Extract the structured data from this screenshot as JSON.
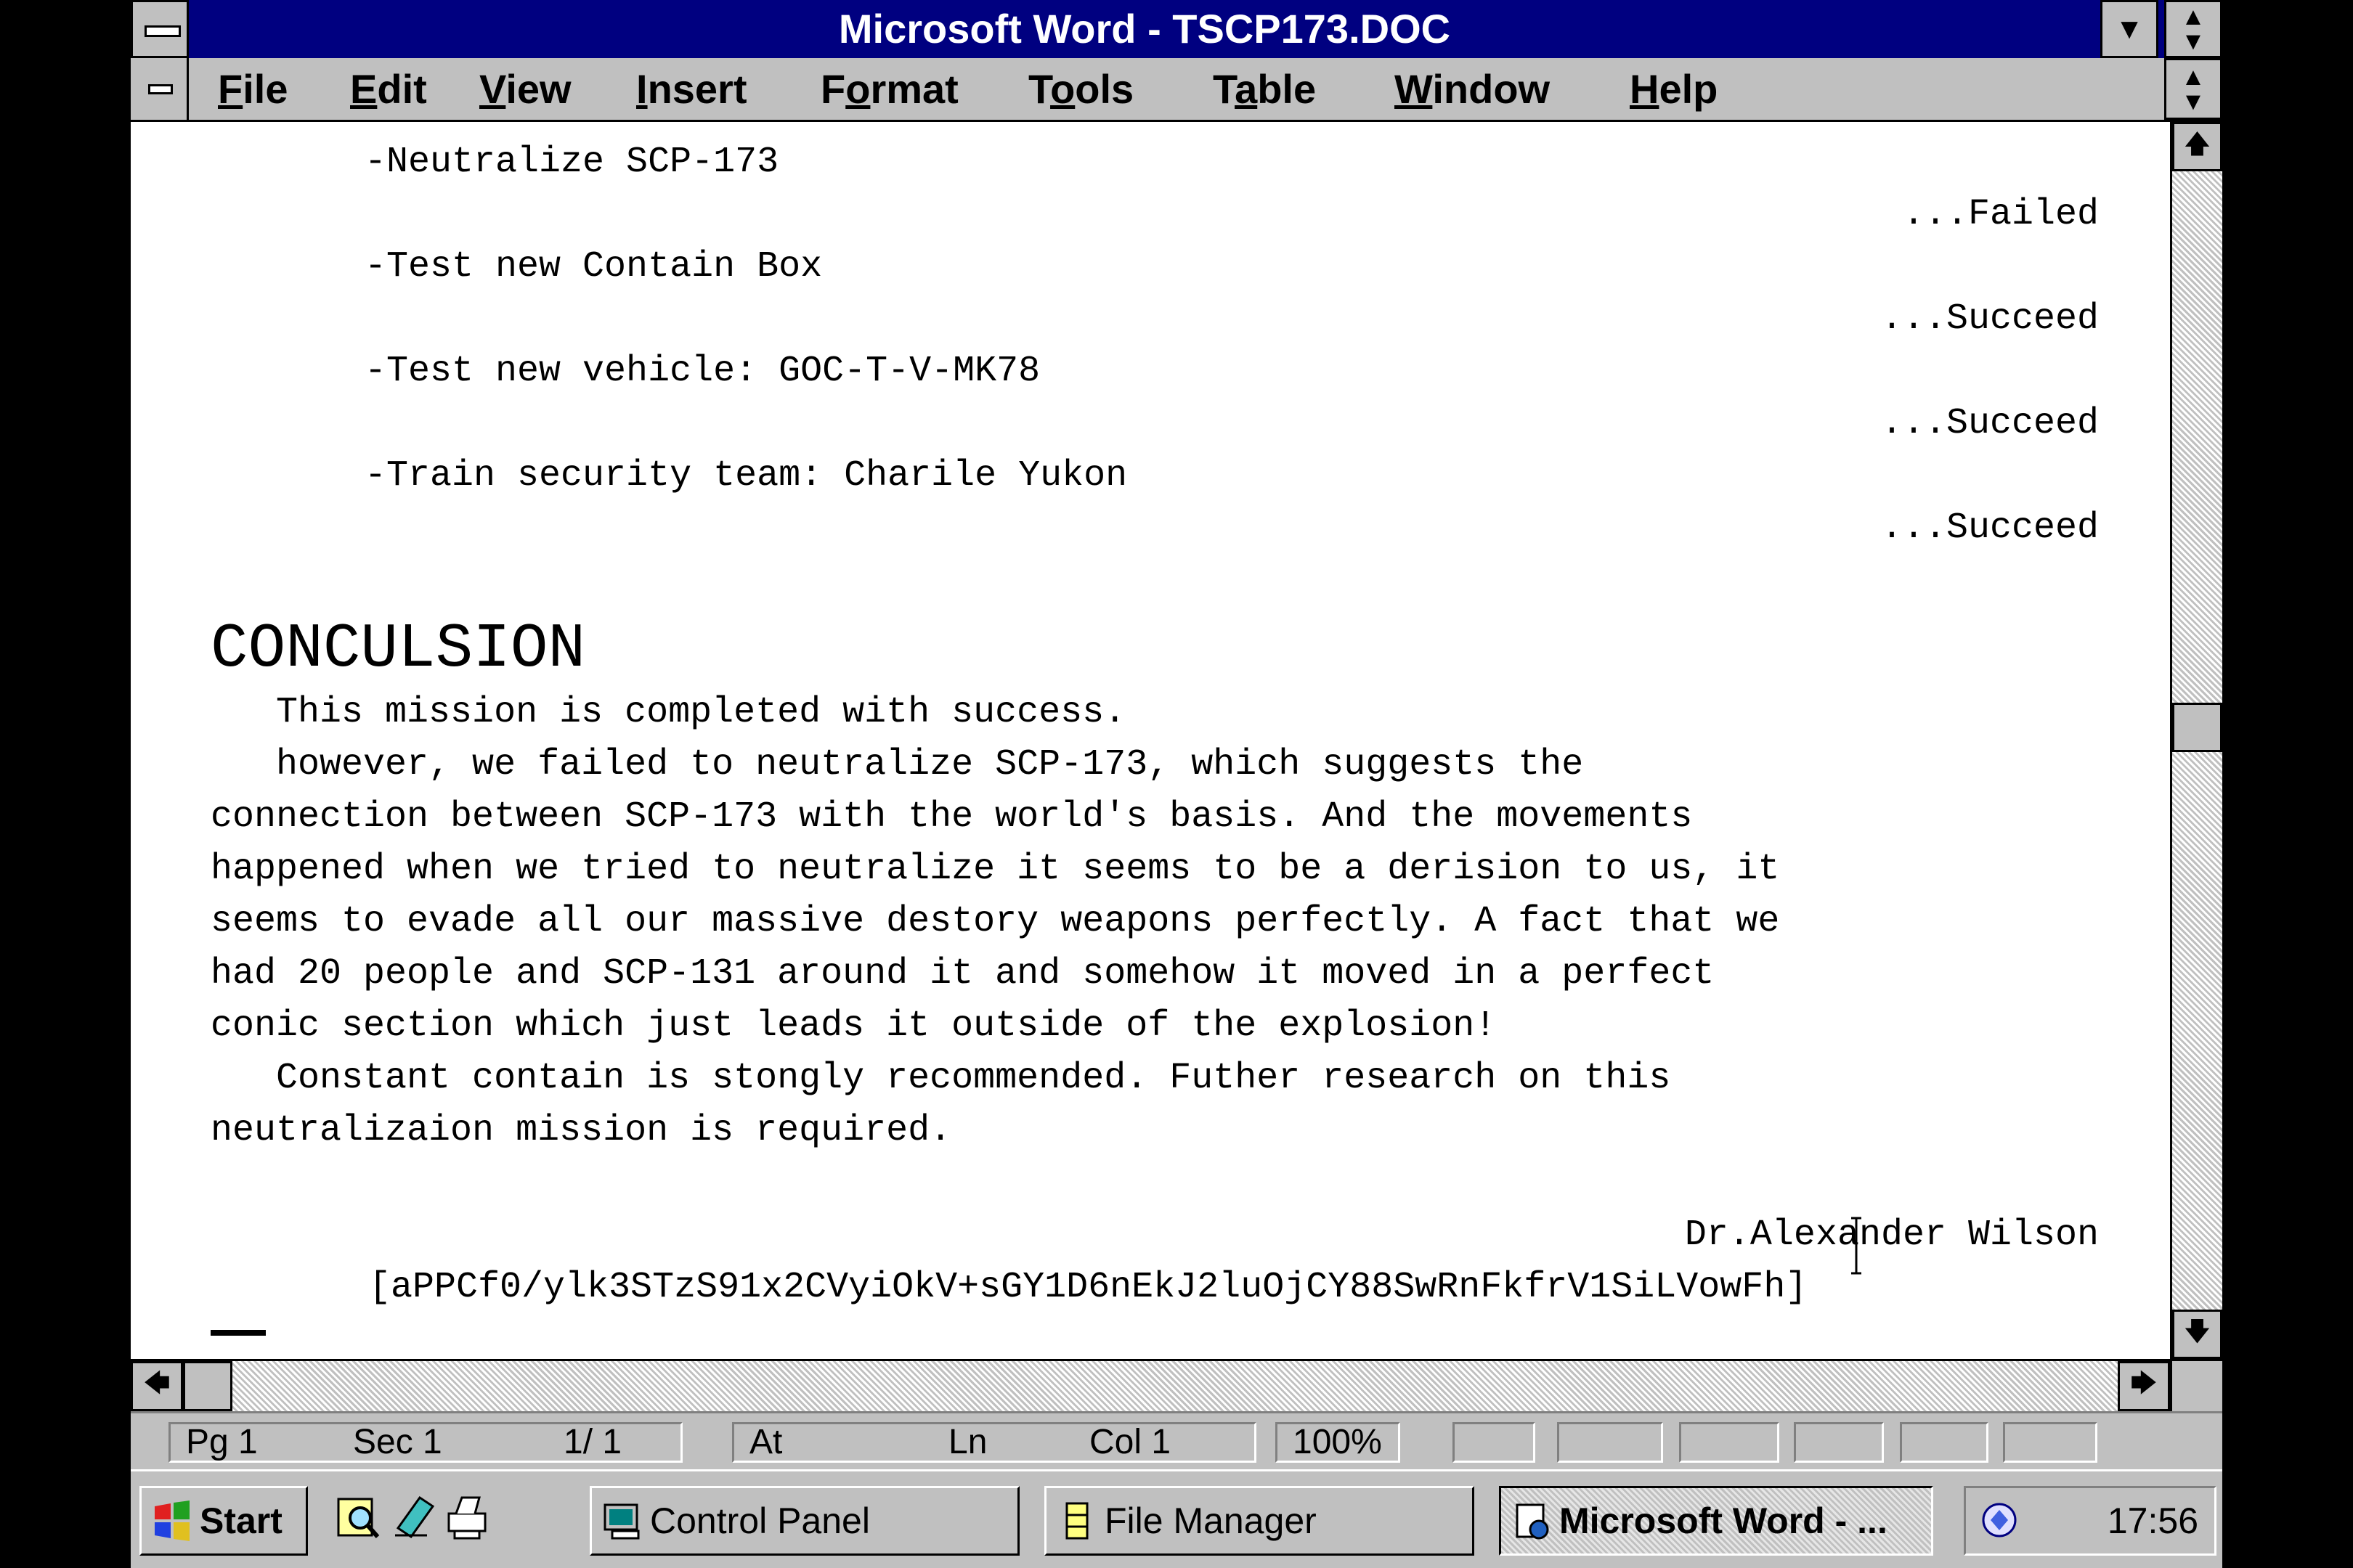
{
  "window": {
    "title": "Microsoft Word - TSCP173.DOC"
  },
  "menu": {
    "items": [
      {
        "pre": "",
        "u": "F",
        "post": "ile"
      },
      {
        "pre": "",
        "u": "E",
        "post": "dit"
      },
      {
        "pre": "",
        "u": "V",
        "post": "iew"
      },
      {
        "pre": "",
        "u": "I",
        "post": "nsert"
      },
      {
        "pre": "F",
        "u": "o",
        "post": "rmat"
      },
      {
        "pre": "T",
        "u": "o",
        "post": "ols"
      },
      {
        "pre": "T",
        "u": "a",
        "post": "ble"
      },
      {
        "pre": "",
        "u": "W",
        "post": "indow"
      },
      {
        "pre": "",
        "u": "H",
        "post": "elp"
      }
    ]
  },
  "document": {
    "tasks": [
      {
        "task": "-Neutralize SCP-173",
        "result": "...Failed"
      },
      {
        "task": "-Test new Contain Box",
        "result": "...Succeed"
      },
      {
        "task": "-Test new vehicle: GOC-T-V-MK78",
        "result": "...Succeed"
      },
      {
        "task": "-Train security team: Charile Yukon",
        "result": "...Succeed"
      }
    ],
    "heading": "CONCULSION",
    "body_lines": [
      "   This mission is completed with success.",
      "   however, we failed to neutralize SCP-173, which suggests the",
      "connection between SCP-173 with the world's basis. And the movements",
      "happened when we tried to neutralize it seems to be a derision to us, it",
      "seems to evade all our massive destory weapons perfectly. A fact that we",
      "had 20 people and SCP-131 around it and somehow it moved in a perfect",
      "conic section which just leads it outside of the explosion!",
      "   Constant contain is stongly recommended. Futher research on this",
      "neutralizaion mission is required."
    ],
    "signature": "Dr.Alexander Wilson",
    "hash": "[aPPCf0/ylk3STzS91x2CVyiOkV+sGY1D6nEkJ2luOjCY88SwRnFkfrV1SiLVowFh]"
  },
  "status": {
    "page": "Pg 1",
    "section": "Sec 1",
    "pages": "1/ 1",
    "at": "At",
    "ln": "Ln",
    "col": "Col 1",
    "zoom": "100%"
  },
  "taskbar": {
    "start": "Start",
    "buttons": [
      {
        "label": "Control Panel",
        "active": false
      },
      {
        "label": "File Manager",
        "active": false
      },
      {
        "label": "Microsoft Word - ...",
        "active": true
      }
    ],
    "clock": "17:56"
  }
}
